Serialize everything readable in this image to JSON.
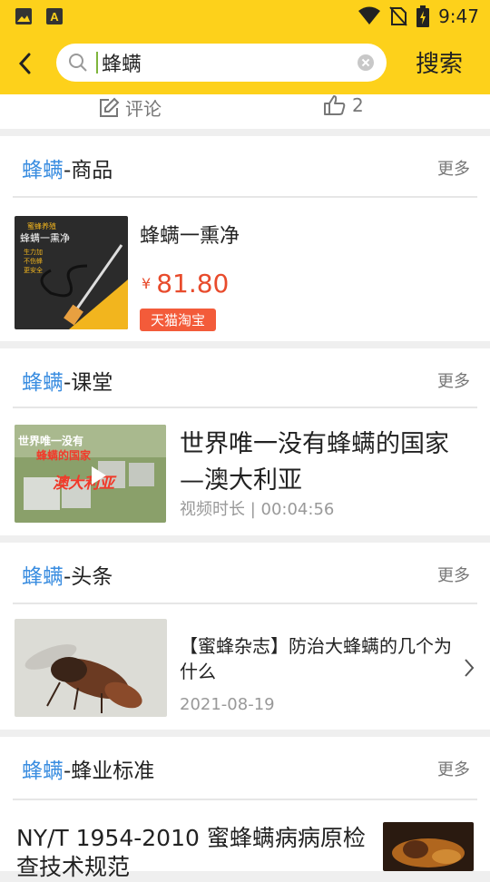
{
  "status_bar": {
    "time": "9:47",
    "left_icons": [
      "image-icon",
      "a-icon"
    ],
    "right_icons": [
      "wifi-icon",
      "no-sim-icon",
      "battery-icon"
    ]
  },
  "header": {
    "search_value": "蜂螨",
    "search_button": "搜索",
    "background_color": "#fdd11b"
  },
  "post_meta": {
    "comment_label": "评论",
    "like_count": "2"
  },
  "sections": {
    "goods": {
      "keyword": "蜂螨",
      "suffix": "-商品",
      "more": "更多",
      "item": {
        "title": "蜂螨一熏净",
        "price_symbol": "¥",
        "price": "81.80",
        "badge": "天猫淘宝",
        "thumb_texts": [
          "蜜蜂养殖",
          "蜂螨一熏净",
          "生力加",
          "不伤蜂",
          "更安全"
        ]
      }
    },
    "course": {
      "keyword": "蜂螨",
      "suffix": "-课堂",
      "more": "更多",
      "item": {
        "title": "世界唯一没有蜂螨的国家—澳大利亚",
        "duration": "视频时长 | 00:04:56",
        "thumb_texts": [
          "世界唯一没有",
          "蜂螨的国家",
          "澳大利亚"
        ]
      }
    },
    "news": {
      "keyword": "蜂螨",
      "suffix": "-头条",
      "more": "更多",
      "item": {
        "title": "【蜜蜂杂志】防治大蜂螨的几个为什么",
        "date": "2021-08-19"
      }
    },
    "standard": {
      "keyword": "蜂螨",
      "suffix": "-蜂业标准",
      "more": "更多",
      "item": {
        "title": "NY/T 1954-2010 蜜蜂螨病病原检查技术规范"
      }
    }
  },
  "colors": {
    "keyword": "#3a8de0",
    "price": "#e84b2c",
    "badge": "#f35b3a"
  }
}
